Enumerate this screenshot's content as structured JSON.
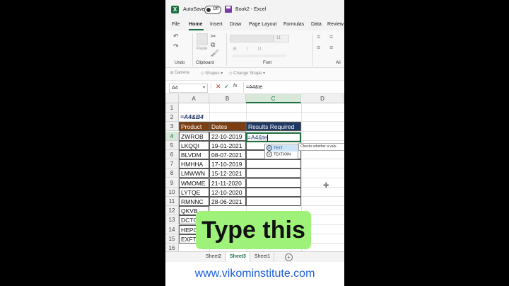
{
  "titlebar": {
    "autosave_label": "AutoSave",
    "toggle_state": "Off",
    "doc_title": "Book2 - Excel"
  },
  "ribbon_tabs": [
    "File",
    "Home",
    "Insert",
    "Draw",
    "Page Layout",
    "Formulas",
    "Data",
    "Review"
  ],
  "ribbon": {
    "undo_label": "Undo",
    "clipboard_label": "Clipboard",
    "paste_label": "Paste",
    "font_label": "Font",
    "font_size": "11",
    "align_label": "Ali"
  },
  "quick_toolbar": {
    "camera": "Camera",
    "shapes": "Shapes",
    "change_shape": "Change Shape"
  },
  "formula_bar": {
    "namebox": "A4",
    "formula": "=A4&te"
  },
  "columns": [
    "A",
    "B",
    "C",
    "D"
  ],
  "rows": [
    "1",
    "2",
    "3",
    "4",
    "5",
    "6",
    "7",
    "8",
    "9",
    "10",
    "11",
    "12",
    "13",
    "14",
    "15",
    "16"
  ],
  "formula_label": "=A4&B4",
  "table": {
    "headers": [
      "Product",
      "Dates",
      "Results Required"
    ],
    "rows": [
      [
        "ZWROB",
        "22-10-2019"
      ],
      [
        "LKQQI",
        "19-01-2021"
      ],
      [
        "BLVDM",
        "08-07-2021"
      ],
      [
        "HMHHA",
        "17-10-2019"
      ],
      [
        "LMWWN",
        "15-12-2021"
      ],
      [
        "WMOME",
        "21-11-2020"
      ],
      [
        "LYTQE",
        "12-10-2020"
      ],
      [
        "RMNNC",
        "28-06-2021"
      ],
      [
        "QKVB",
        ""
      ],
      [
        "DCTG",
        ""
      ],
      [
        "HEPC",
        ""
      ],
      [
        "EXFT",
        ""
      ]
    ]
  },
  "editing_text": "=A4&te",
  "autocomplete": {
    "items": [
      "TEXT",
      "TEXTJOIN"
    ],
    "tooltip": "Checks whether a valu"
  },
  "sheet_tabs": [
    "Sheet2",
    "Sheet3",
    "Sheet1"
  ],
  "overlay_text": "Type this",
  "footer_url": "www.vikominstitute.com",
  "colors": {
    "excel_green": "#1d6f42",
    "header_brown": "#7b3f12",
    "header_navy": "#1f3864",
    "overlay_green": "#9ef27a",
    "footer_blue": "#1c5fd9"
  }
}
